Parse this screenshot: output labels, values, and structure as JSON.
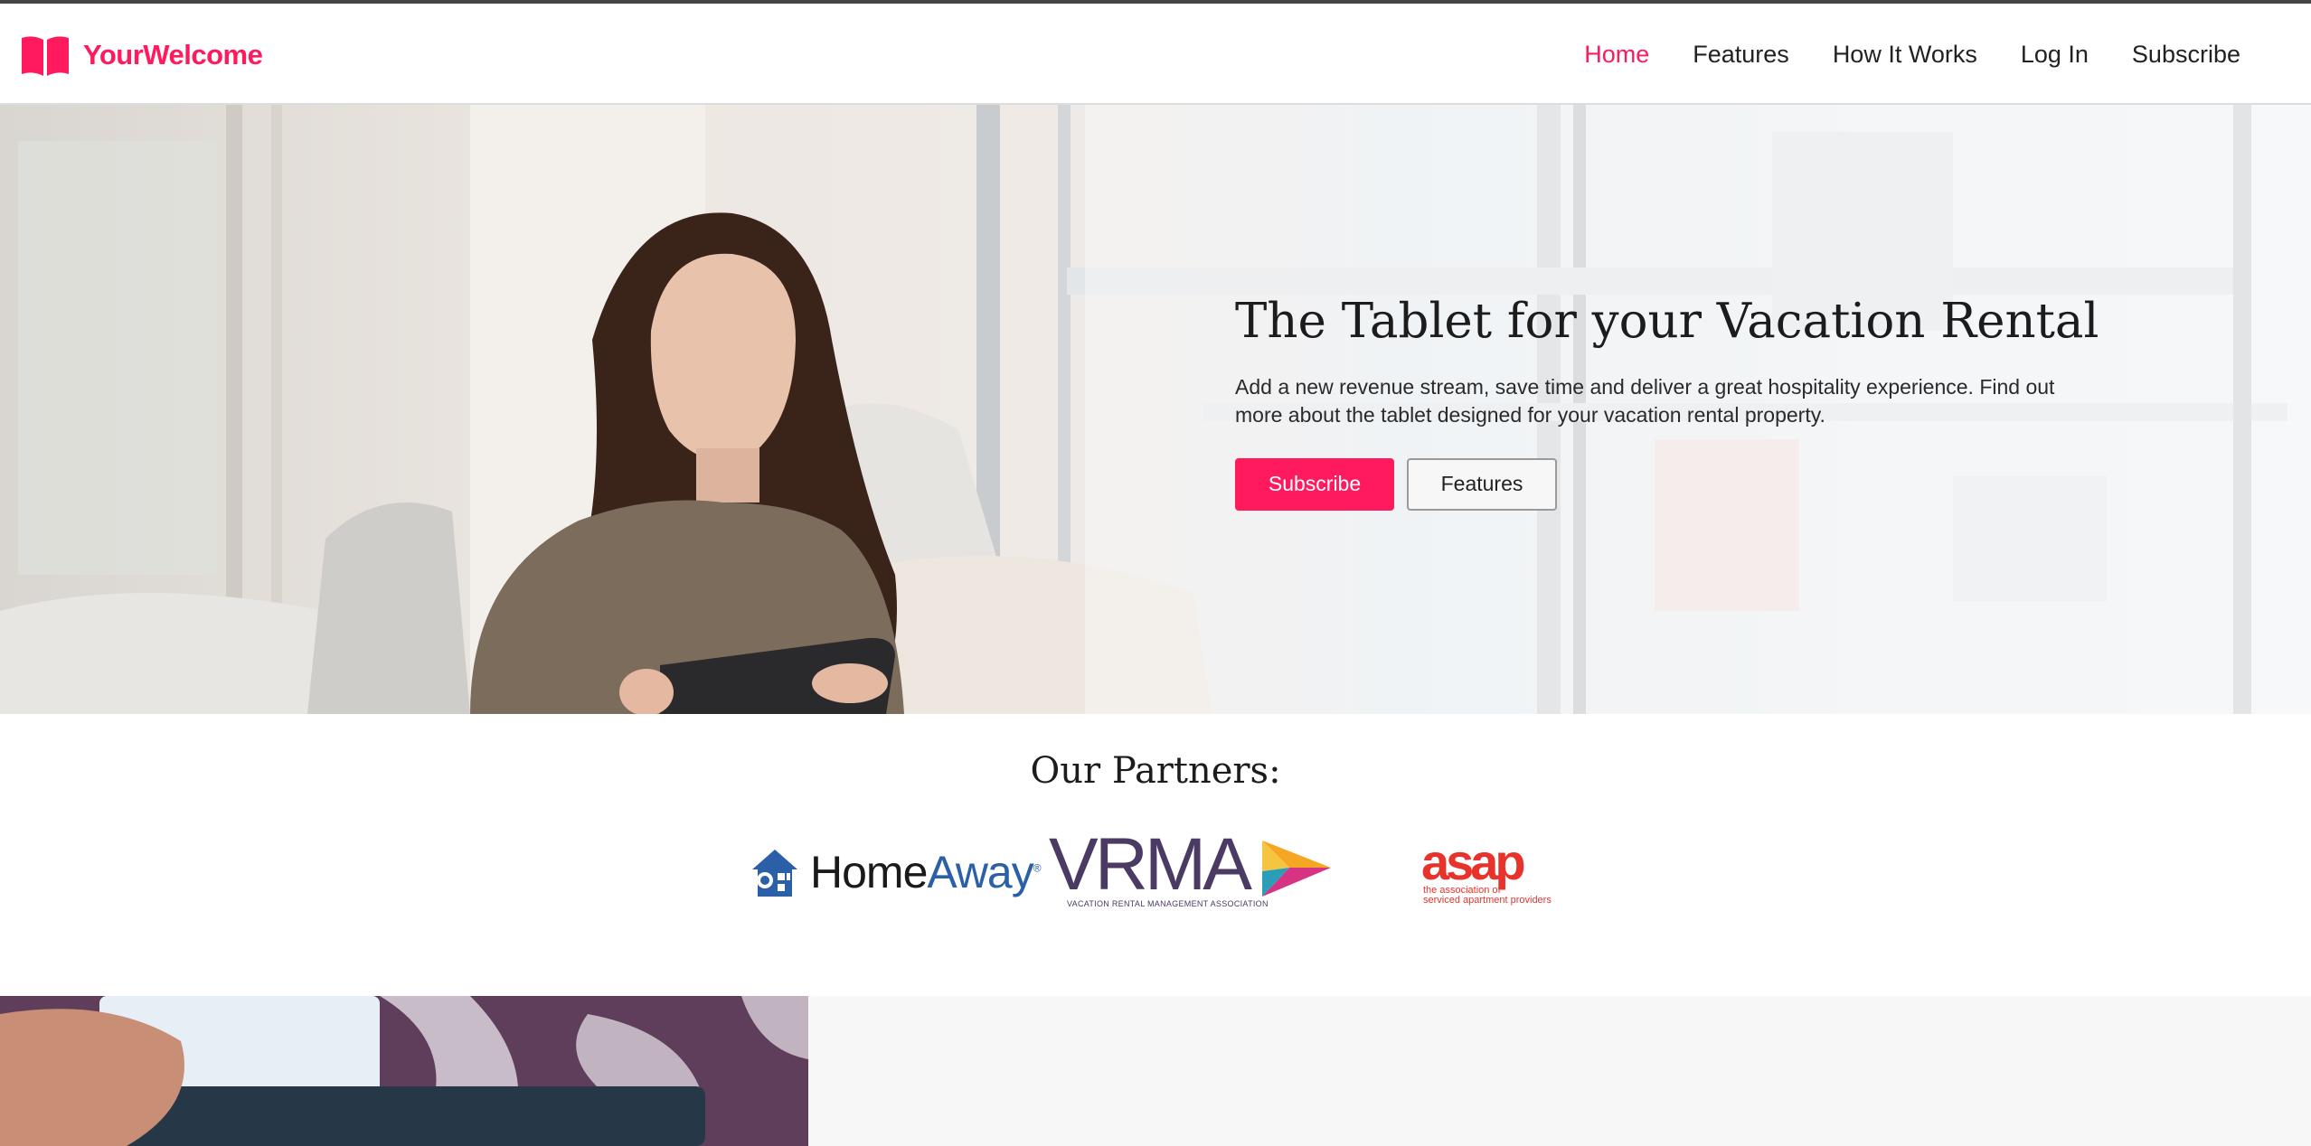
{
  "brand": {
    "name": "YourWelcome",
    "logo_icon": "open-book-icon",
    "accent": "#ff1a5e"
  },
  "nav": [
    {
      "label": "Home",
      "active": true
    },
    {
      "label": "Features",
      "active": false
    },
    {
      "label": "How It Works",
      "active": false
    },
    {
      "label": "Log In",
      "active": false
    },
    {
      "label": "Subscribe",
      "active": false
    }
  ],
  "hero": {
    "title": "The Tablet for your Vacation Rental",
    "subtitle": "Add a new revenue stream, save time and deliver a great hospitality experience. Find out more about the tablet designed for your vacation rental property.",
    "primary_button": "Subscribe",
    "secondary_button": "Features",
    "image": "woman-using-tablet-photo"
  },
  "partners": {
    "title": "Our Partners:",
    "homeaway": {
      "home": "Home",
      "away": "Away",
      "reg": "®"
    },
    "vrma": {
      "letters": "VRMA",
      "caption": "VACATION RENTAL MANAGEMENT ASSOCIATION"
    },
    "asap": {
      "word": "asap",
      "caption_line1": "the association of",
      "caption_line2": "serviced apartment providers"
    }
  },
  "bottom": {
    "image": "credit-card-tablet-photo"
  }
}
